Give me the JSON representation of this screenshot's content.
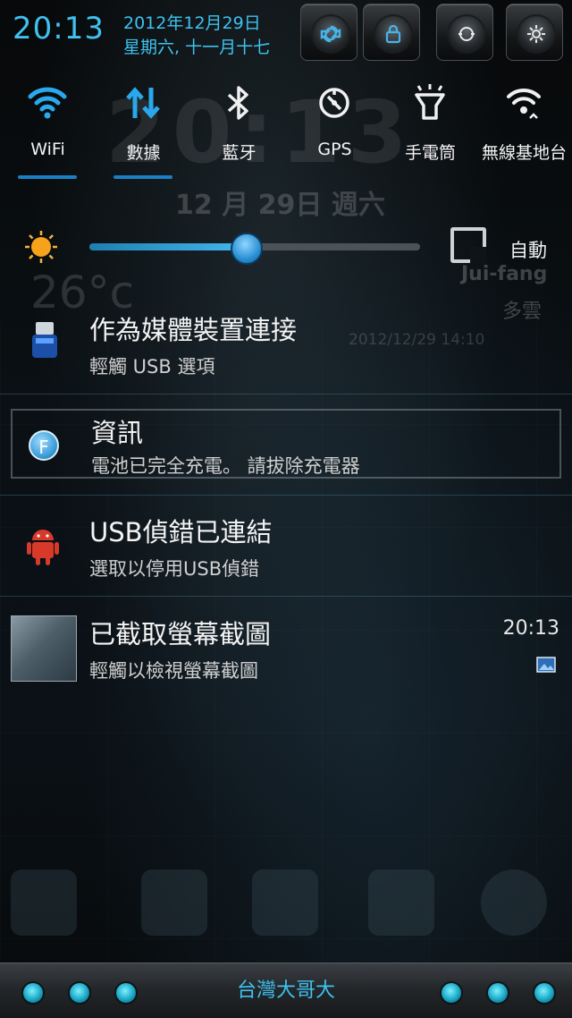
{
  "header": {
    "time": "20:13",
    "date_line1": "2012年12月29日",
    "date_line2": "星期六, 十一月十七",
    "buttons": [
      {
        "name": "sync-button",
        "icon": "sync-icon"
      },
      {
        "name": "lock-button",
        "icon": "lock-icon"
      },
      {
        "name": "rotate-button",
        "icon": "rotate-icon"
      },
      {
        "name": "settings-button",
        "icon": "settings-icon"
      }
    ]
  },
  "toggles": [
    {
      "label": "WiFi",
      "icon": "wifi-icon",
      "active": true
    },
    {
      "label": "數據",
      "icon": "data-icon",
      "active": true
    },
    {
      "label": "藍牙",
      "icon": "bluetooth-icon",
      "active": false
    },
    {
      "label": "GPS",
      "icon": "gps-icon",
      "active": false
    },
    {
      "label": "手電筒",
      "icon": "flashlight-icon",
      "active": false
    },
    {
      "label": "無線基地台",
      "icon": "hotspot-icon",
      "active": false
    }
  ],
  "wallpaper": {
    "clock": "20:13",
    "date": "12 月 29日 週六",
    "temperature": "26°c",
    "city": "Jui-fang",
    "weather": "多雲",
    "updated": "2012/12/29 14:10"
  },
  "brightness": {
    "level": 0.47,
    "auto_label": "自動"
  },
  "notifications": [
    {
      "title": "作為媒體裝置連接",
      "subtitle": "輕觸 USB 選項",
      "icon": "usb-icon",
      "time": ""
    },
    {
      "title": "資訊",
      "subtitle": "電池已完全充電。 請拔除充電器",
      "icon": "info-f-icon",
      "time": ""
    },
    {
      "title": "USB偵錯已連結",
      "subtitle": "選取以停用USB偵錯",
      "icon": "android-icon",
      "time": ""
    },
    {
      "title": "已截取螢幕截圖",
      "subtitle": "輕觸以檢視螢幕截圖",
      "icon": "screenshot-thumbnail",
      "time": "20:13"
    }
  ],
  "carrier": {
    "label": "台灣大哥大"
  },
  "colors": {
    "accent": "#3ec2f0",
    "toggle_active": "#1b7fc4"
  }
}
